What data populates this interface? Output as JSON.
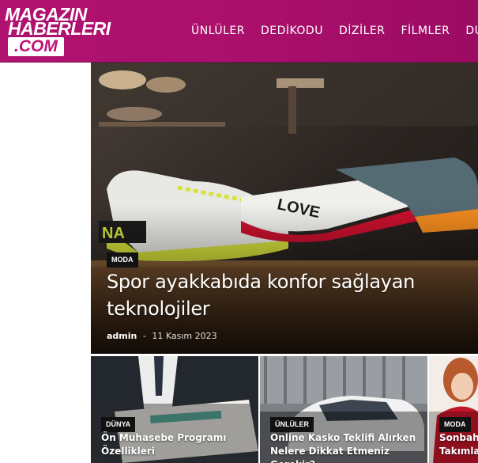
{
  "logo": {
    "line1": "MAGAZIN",
    "line2": "HABERLERI",
    "line3": ".COM"
  },
  "nav": {
    "items": [
      {
        "label": "ÜNLÜLER"
      },
      {
        "label": "DEDİKODU"
      },
      {
        "label": "DİZİLER"
      },
      {
        "label": "FİLMLER"
      },
      {
        "label": "DU"
      }
    ]
  },
  "hero": {
    "category": "MODA",
    "title": "Spor ayakkabıda konfor sağlayan teknolojiler",
    "author": "admin",
    "separator": "-",
    "date": "11 Kasım 2023",
    "shoe_text_1": "NA",
    "shoe_text_2": "LOVE"
  },
  "cards": [
    {
      "category": "DÜNYA",
      "title": "Ön Muhasebe Programı Özellikleri"
    },
    {
      "category": "ÜNLÜLER",
      "title": "Online Kasko Teklifi Alırken Nelere Dikkat Etmeniz Gerekir?"
    },
    {
      "category": "MODA",
      "title": "Sonbaha Takımla"
    }
  ],
  "colors": {
    "brand": "#b0126f",
    "tag_bg": "#111111"
  }
}
